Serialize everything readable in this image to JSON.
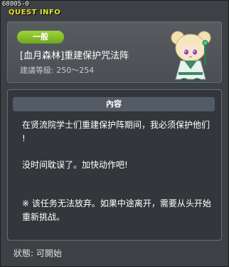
{
  "window": {
    "id_label": "68005-0",
    "title": "QUEST INFO"
  },
  "quest": {
    "category_badge": "一般",
    "name": "[血月森林]重建保护咒法阵",
    "level_range": "建議等級: 250～254"
  },
  "content": {
    "header": "內容",
    "paragraph_1_line_1": "在贤流院学士们重建保护阵期间，我必须保护他们",
    "paragraph_1_line_2": "!",
    "paragraph_2": "没时间耽误了。加快动作吧!",
    "note_line_1": "※ 该任务无法放弃。如果中途离开，需要从头开始",
    "note_line_2": "重新挑战。"
  },
  "status": {
    "text": "狀態: 可開始"
  },
  "colors": {
    "title": "#e8e02a",
    "badge": "#8cc42c",
    "header_bar": "#535c66",
    "background": "#3d4044"
  },
  "icons": {
    "portrait": "npc-portrait-icon"
  }
}
